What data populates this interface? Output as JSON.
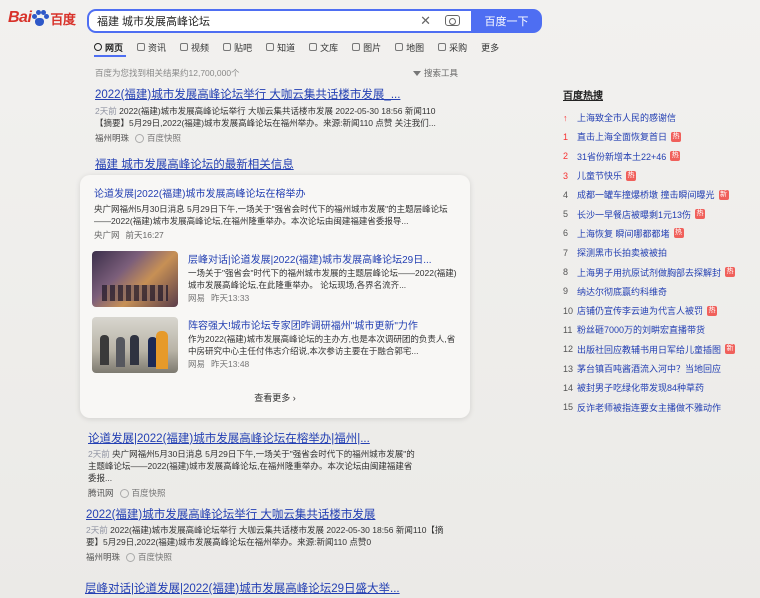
{
  "logo": {
    "part1": "Bai",
    "part2": "百度"
  },
  "search": {
    "query": "福建 城市发展高峰论坛",
    "button_label": "百度一下"
  },
  "tabs": [
    "网页",
    "资讯",
    "视频",
    "贴吧",
    "知道",
    "文库",
    "图片",
    "地图",
    "采购",
    "更多"
  ],
  "result_count": "百度为您找到相关结果约12,700,000个",
  "search_tools": "搜索工具",
  "results": [
    {
      "title": "2022(福建)城市发展高峰论坛举行 大咖云集共话楼市发展_...",
      "snippet_time": "2天前",
      "snippet": "2022(福建)城市发展高峰论坛举行 大咖云集共话楼市发展 2022-05-30 18:56 新闻110【摘要】5月29日,2022(福建)城市发展高峰论坛在福州举办。来源:新闻110 点赞 关注我们...",
      "source": "福州明珠",
      "snapshot": "百度快照"
    }
  ],
  "news": {
    "heading": "福建 城市发展高峰论坛的最新相关信息",
    "main": {
      "title": "论道发展|2022(福建)城市发展高峰论坛在榕举办",
      "snippet": "央广网福州5月30日消息 5月29日下午,一场关于\"强省会时代下的福州城市发展\"的主题层峰论坛——2022(福建)城市发展高峰论坛,在福州隆重举办。本次论坛由闽建福建省委报导...",
      "source": "央广网",
      "time": "前天16:27"
    },
    "items": [
      {
        "title": "层峰对话|论道发展|2022(福建)城市发展高峰论坛29日...",
        "snippet": "一场关于\"强省会\"时代下的福州城市发展的主题层峰论坛——2022(福建)城市发展高峰论坛,在此隆重举办。 论坛现场,各界名流齐...",
        "source": "网易",
        "time": "昨天13:33"
      },
      {
        "title": "阵容强大!城市论坛专家团昨调研福州\"城市更新\"力作",
        "snippet": "作为2022(福建)城市发展高峰论坛的主办方,也是本次调研团的负责人,省中房研究中心主任付伟志介绍说,本次参访主要在于融合郭宅...",
        "source": "网易",
        "time": "昨天13:48"
      }
    ],
    "see_more": "查看更多 ›"
  },
  "results_more": [
    {
      "title": "论道发展|2022(福建)城市发展高峰论坛在榕举办|福州|...",
      "snippet_time": "2天前",
      "snippet": "央广网福州5月30日消息 5月29日下午,一场关于\"强省会时代下的福州城市发展\"的主题峰论坛——2022(福建)城市发展高峰论坛,在福州隆重举办。本次论坛由闽建福建省委报...",
      "source": "腾讯网",
      "snapshot": "百度快照"
    },
    {
      "title": "2022(福建)城市发展高峰论坛举行 大咖云集共话楼市发展",
      "snippet_time": "2天前",
      "snippet": "2022(福建)城市发展高峰论坛举行 大咖云集共话楼市发展 2022-05-30 18:56 新闻110【摘要】5月29日,2022(福建)城市发展高峰论坛在福州举办。来源:新闻110 点赞0",
      "source": "福州明珠",
      "snapshot": "百度快照"
    },
    {
      "title": "层峰对话|论道发展|2022(福建)城市发展高峰论坛29日盛大举..."
    }
  ],
  "hot": {
    "title": "百度热搜",
    "items": [
      {
        "rank": "↑",
        "text": "上海致全市人民的感谢信",
        "tag": ""
      },
      {
        "rank": "1",
        "text": "直击上海全面恢复首日",
        "tag": "热"
      },
      {
        "rank": "2",
        "text": "31省份新增本土22+46",
        "tag": "热"
      },
      {
        "rank": "3",
        "text": "儿童节快乐",
        "tag": "热"
      },
      {
        "rank": "4",
        "text": "成都一罐车撞爆桥墩 撞击瞬间曝光",
        "tag": "新"
      },
      {
        "rank": "5",
        "text": "长沙一早餐店被曝剩1元13伤",
        "tag": "热"
      },
      {
        "rank": "6",
        "text": "上海恢复 瞬间哪都都堵",
        "tag": "热"
      },
      {
        "rank": "7",
        "text": "探测黑市长拍卖被被拍",
        "tag": ""
      },
      {
        "rank": "8",
        "text": "上海男子用抗原试剂做胸部去探解封",
        "tag": "热"
      },
      {
        "rank": "9",
        "text": "纳达尔彻底赢约科维奇",
        "tag": ""
      },
      {
        "rank": "10",
        "text": "店铺仍宣传李云迪为代言人被罚",
        "tag": "热"
      },
      {
        "rank": "11",
        "text": "粉丝砸7000万的刘畊宏直播带货",
        "tag": ""
      },
      {
        "rank": "12",
        "text": "出版社回应教辅书用日军给儿童插图",
        "tag": "新"
      },
      {
        "rank": "13",
        "text": "茅台镇百吨酱酒流入河中？当地回应",
        "tag": ""
      },
      {
        "rank": "14",
        "text": "被封男子吃绿化带发现84种草药",
        "tag": ""
      },
      {
        "rank": "15",
        "text": "反诈老师被指连要女主播做不雅动作",
        "tag": ""
      }
    ]
  }
}
